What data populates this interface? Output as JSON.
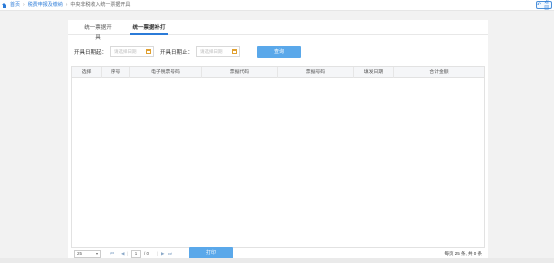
{
  "breadcrumb": {
    "items": [
      "首页",
      "税费申报及缴纳",
      "中央非税收入统一票据开具"
    ]
  },
  "back_button": {
    "label": "返回"
  },
  "tabs": [
    {
      "label": "统一票据开具"
    },
    {
      "label": "统一票据补打",
      "active": true
    }
  ],
  "query": {
    "start_label": "开具日期起：",
    "start_placeholder": "请选择日期",
    "end_label": "开具日期止：",
    "end_placeholder": "请选择日期",
    "search_label": "查询"
  },
  "table": {
    "columns": [
      "选择",
      "序号",
      "电子税票号码",
      "票据代码",
      "票据号码",
      "填发日期",
      "合计金额"
    ],
    "rows": []
  },
  "pager": {
    "page_size": "25",
    "first": "⏮",
    "prev": "◀",
    "current_page": "1",
    "of_text": "/ 0",
    "next": "▶",
    "last": "⏭",
    "summary": "每页 25 条, 共 0 条"
  },
  "print_button": {
    "label": "打印"
  },
  "colors": {
    "accent": "#2b7bd8",
    "button": "#5aa8ea"
  }
}
